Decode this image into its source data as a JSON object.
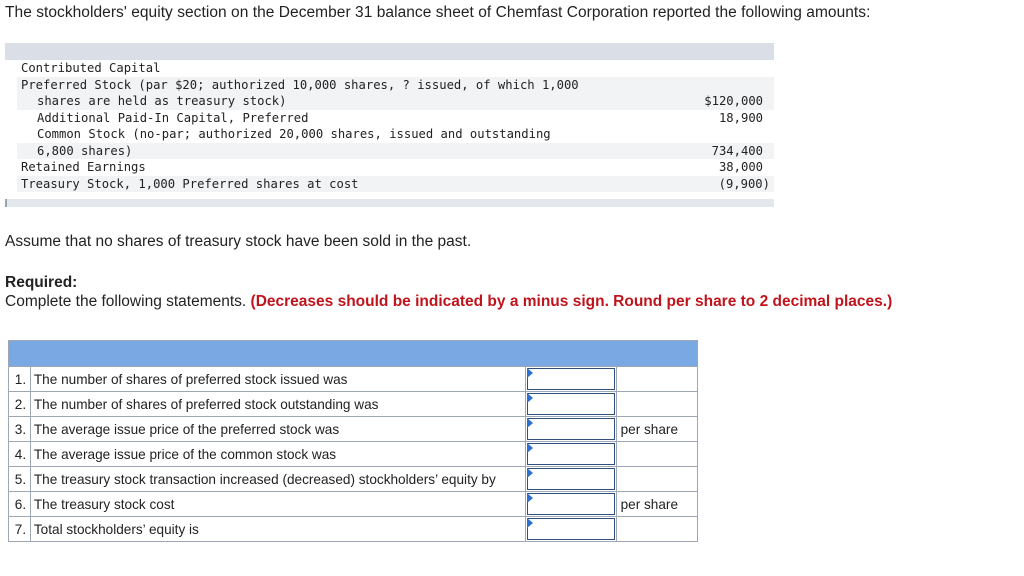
{
  "intro": "The stockholders' equity section on the December 31 balance sheet of Chemfast Corporation reported the following amounts:",
  "ledger": {
    "lines": [
      {
        "text": "Contributed Capital",
        "indent": false,
        "amount": ""
      },
      {
        "text": "Preferred Stock (par $20; authorized 10,000 shares, ? issued, of which 1,000",
        "indent": false,
        "amount": ""
      },
      {
        "text": "shares are held as treasury stock)",
        "indent": true,
        "amount": "$120,000"
      },
      {
        "text": "Additional Paid-In Capital, Preferred",
        "indent": true,
        "amount": "18,900"
      },
      {
        "text": "Common Stock (no-par; authorized 20,000 shares, issued and outstanding",
        "indent": true,
        "amount": ""
      },
      {
        "text": "6,800 shares)",
        "indent": true,
        "amount": "734,400"
      },
      {
        "text": "Retained Earnings",
        "indent": false,
        "amount": "38,000"
      },
      {
        "text": "Treasury Stock, 1,000 Preferred shares at cost",
        "indent": false,
        "amount": "(9,900)"
      }
    ]
  },
  "assume": "Assume that no shares of treasury stock have been sold in the past.",
  "required": {
    "heading": "Required:",
    "text": "Complete the following statements.",
    "note": "(Decreases should be indicated by a minus sign. Round per share to 2 decimal places.)"
  },
  "questions": [
    {
      "num": "1.",
      "text": "The number of shares of preferred stock issued was",
      "value": "",
      "unit": ""
    },
    {
      "num": "2.",
      "text": "The number of shares of preferred stock outstanding was",
      "value": "",
      "unit": ""
    },
    {
      "num": "3.",
      "text": "The average issue price of the preferred stock was",
      "value": "",
      "unit": "per share"
    },
    {
      "num": "4.",
      "text": "The average issue price of the common stock was",
      "value": "",
      "unit": ""
    },
    {
      "num": "5.",
      "text": "The treasury stock transaction increased (decreased) stockholders’ equity by",
      "value": "",
      "unit": ""
    },
    {
      "num": "6.",
      "text": "The treasury stock cost",
      "value": "",
      "unit": "per share"
    },
    {
      "num": "7.",
      "text": "Total stockholders’ equity is",
      "value": "",
      "unit": ""
    }
  ]
}
